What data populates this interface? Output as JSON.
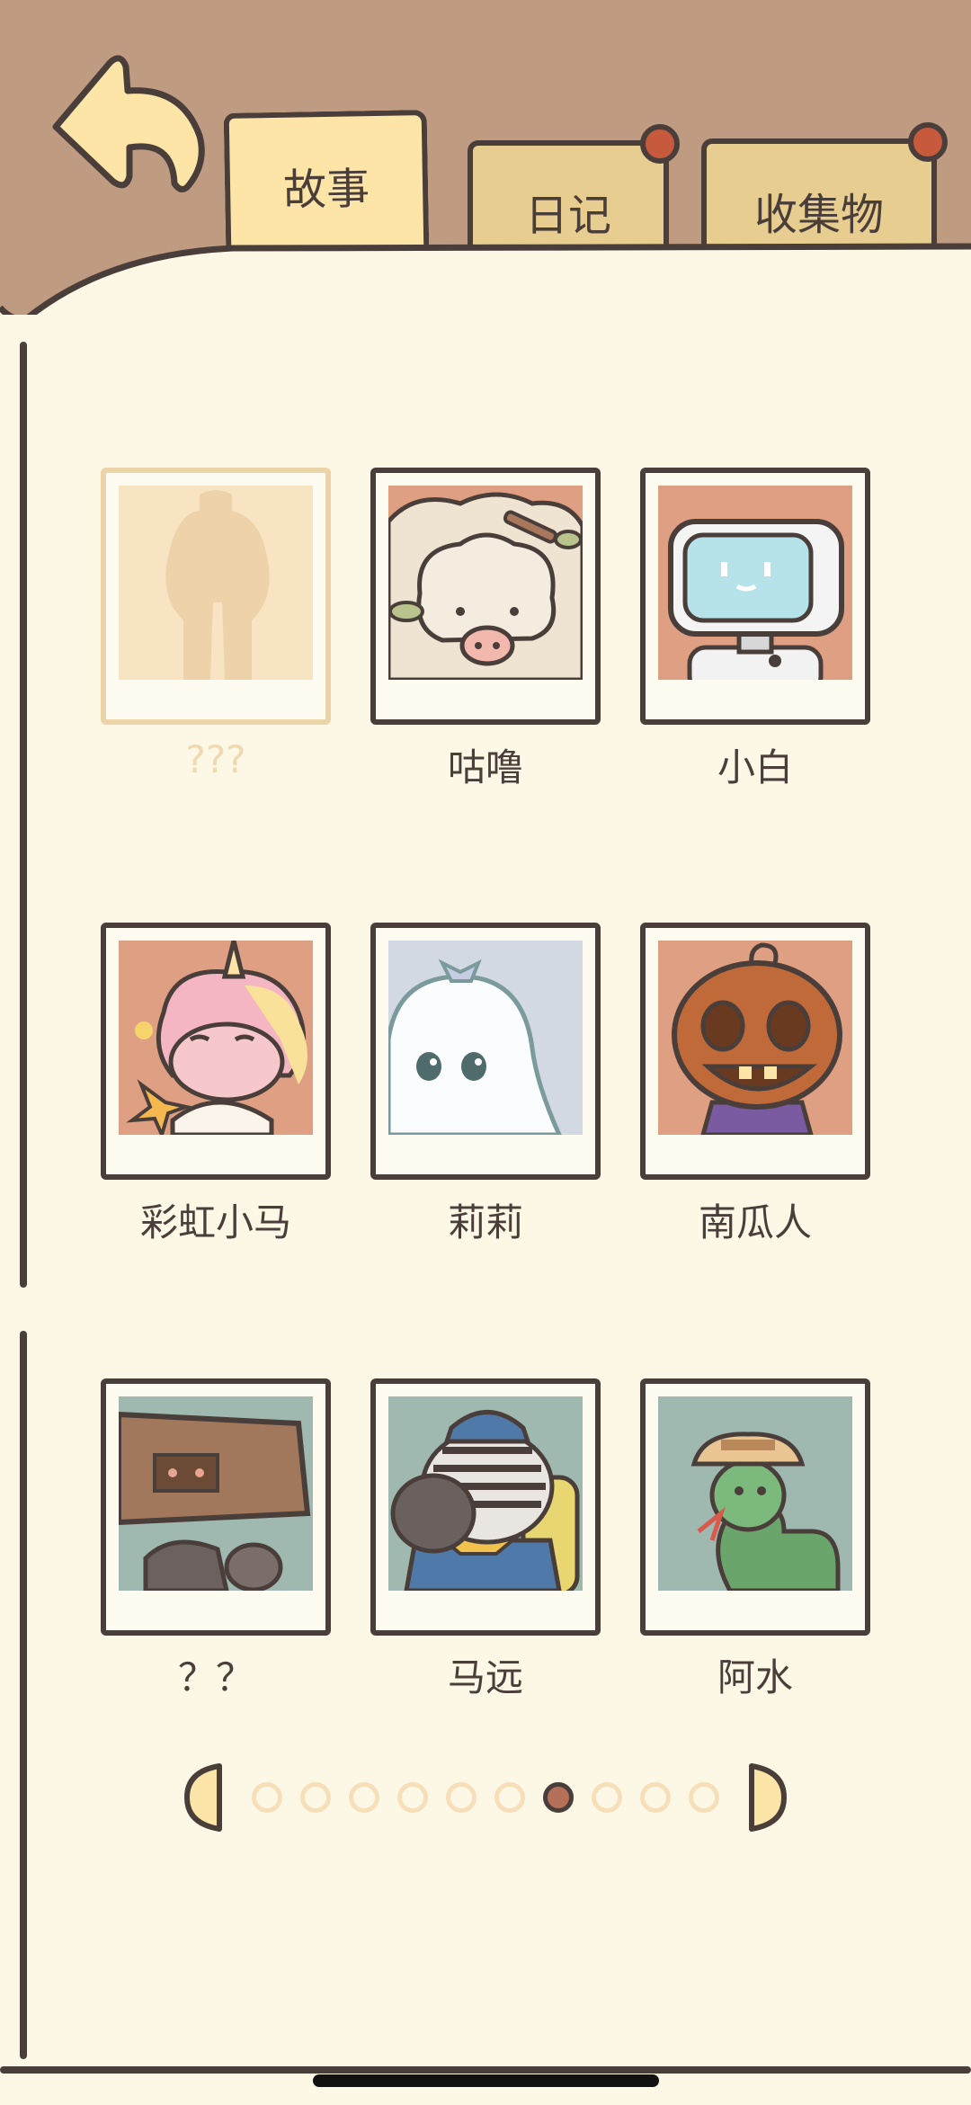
{
  "tabs": [
    {
      "label": "故事",
      "active": true
    },
    {
      "label": "日记",
      "badge": true
    },
    {
      "label": "收集物",
      "badge": true
    }
  ],
  "characters": [
    {
      "name": "???",
      "locked": true,
      "icon": "locked-silhouette"
    },
    {
      "name": "咕噜",
      "icon": "sheep-pig"
    },
    {
      "name": "小白",
      "icon": "robot"
    },
    {
      "name": "彩虹小马",
      "icon": "unicorn"
    },
    {
      "name": "莉莉",
      "icon": "ghost"
    },
    {
      "name": "南瓜人",
      "icon": "pumpkin"
    },
    {
      "name": "？？",
      "icon": "box-head"
    },
    {
      "name": "马远",
      "icon": "zebra"
    },
    {
      "name": "阿水",
      "icon": "snake"
    }
  ],
  "pagination": {
    "total": 10,
    "current": 7
  },
  "colors": {
    "outline": "#4a3e3a",
    "header_bg": "#bf9b82",
    "page_bg": "#fdf7e6",
    "tab_active": "#fde4a7",
    "tab_inactive": "#e7cd8f",
    "badge": "#c75a3d"
  }
}
